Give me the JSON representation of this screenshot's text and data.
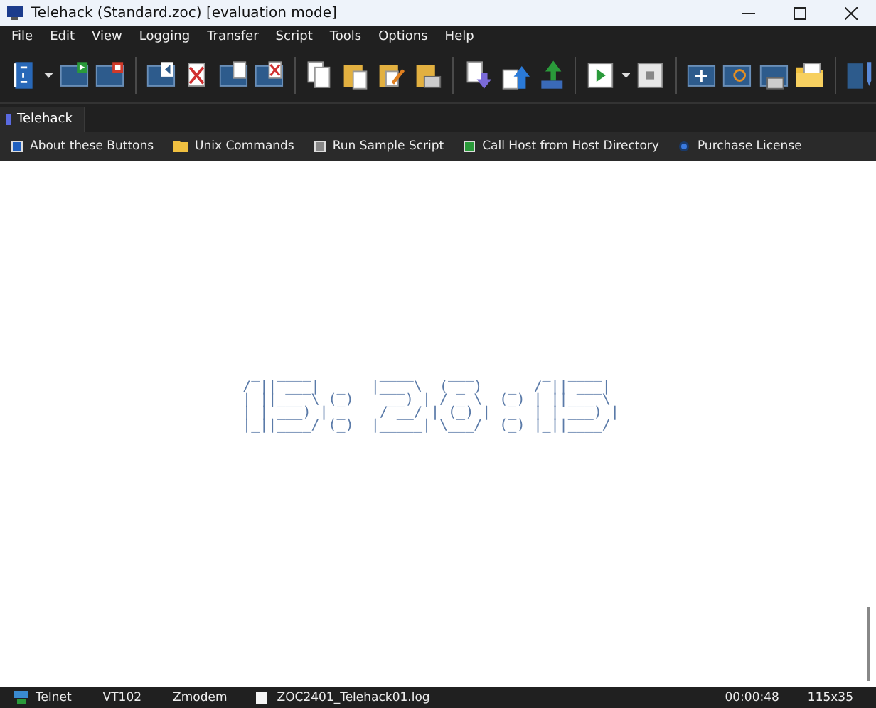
{
  "window": {
    "title": "Telehack (Standard.zoc) [evaluation mode]"
  },
  "menu": [
    "File",
    "Edit",
    "View",
    "Logging",
    "Transfer",
    "Script",
    "Tools",
    "Options",
    "Help"
  ],
  "tabs": [
    {
      "label": "Telehack",
      "selected": true
    }
  ],
  "quick_buttons": [
    {
      "label": "About these Buttons",
      "kind": "info"
    },
    {
      "label": "Unix Commands",
      "kind": "folder"
    },
    {
      "label": "Run Sample Script",
      "kind": "script"
    },
    {
      "label": "Call Host from Host Directory",
      "kind": "host"
    },
    {
      "label": "Purchase License",
      "kind": "radio"
    }
  ],
  "terminal": {
    "clock_lines": [
      " _  ____        ____    ___        _  ____  ",
      "/ || ___|  _   |___ \\  ( _ )   _  / || ___| ",
      "| ||___ \\ (_)    __) | / _ \\  (_) | ||___ \\ ",
      "| | ___) | _    / __/ | (_) |  _  | | ___) |",
      "|_||____/ (_)  |_____| \\___/  (_) |_||____/ "
    ]
  },
  "status_bar": {
    "protocol": "Telnet",
    "emulation": "VT102",
    "transfer": "Zmodem",
    "log_file": "ZOC2401_Telehack01.log",
    "elapsed": "00:00:48",
    "size": "115x35"
  }
}
